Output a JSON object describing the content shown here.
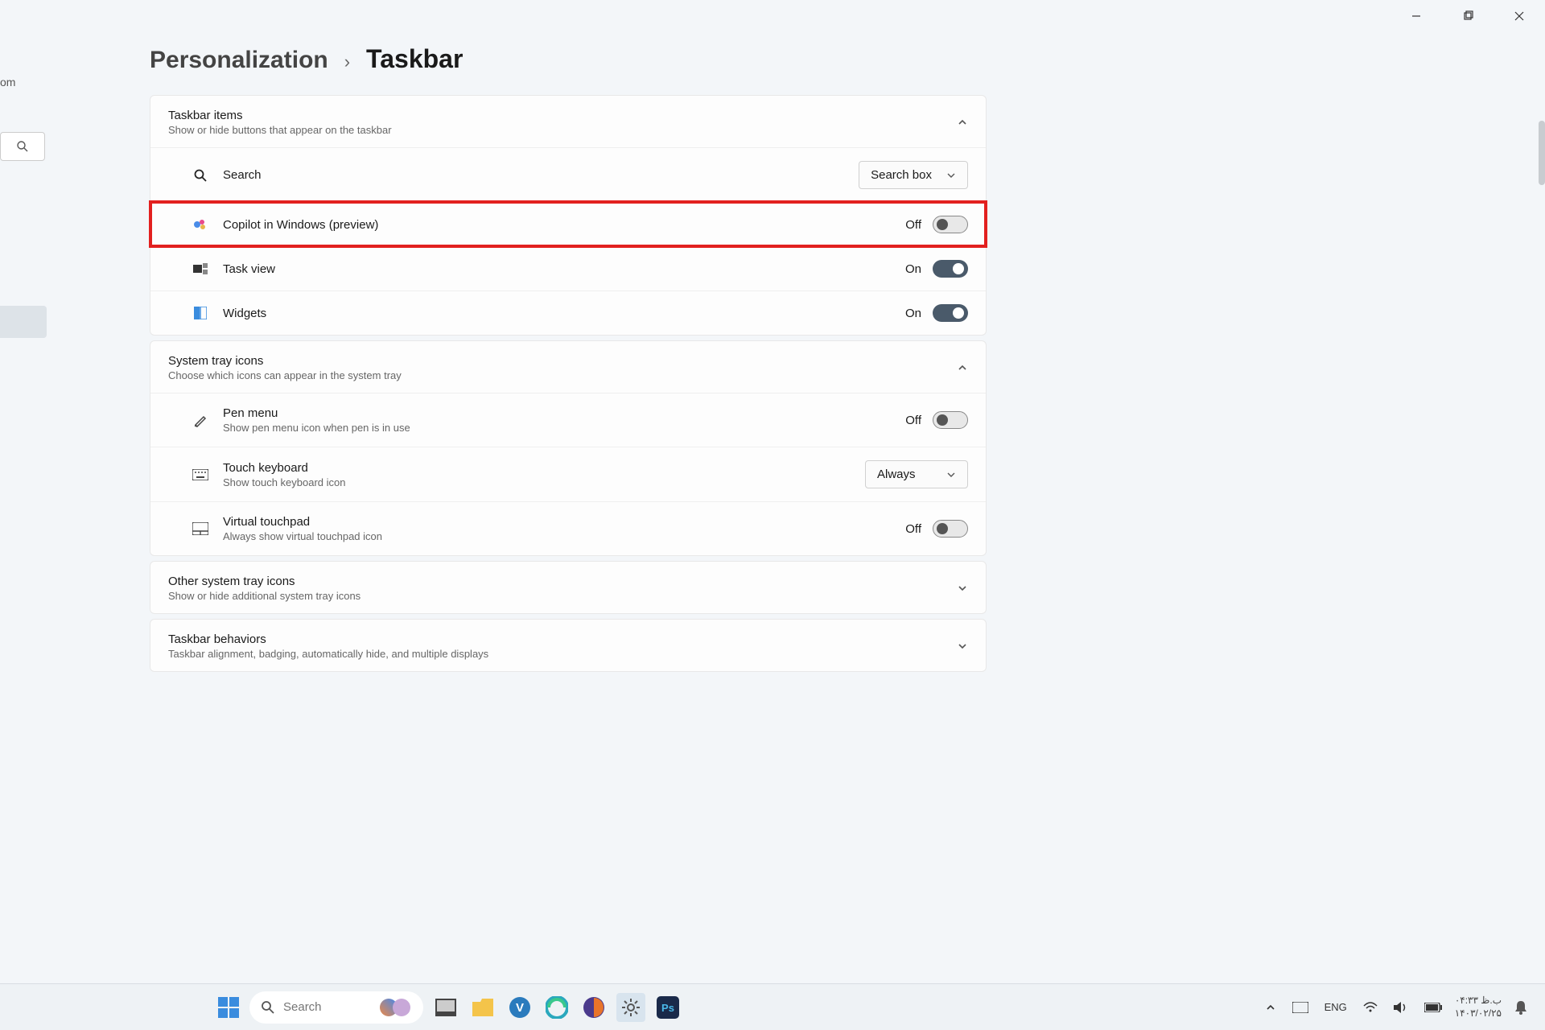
{
  "window": {
    "minimize": "—",
    "maximize": "▢",
    "close": "✕"
  },
  "sidebar": {
    "fragment_label": "om"
  },
  "breadcrumb": {
    "parent": "Personalization",
    "sep": "›",
    "current": "Taskbar"
  },
  "sections": {
    "taskbar_items": {
      "title": "Taskbar items",
      "subtitle": "Show or hide buttons that appear on the taskbar",
      "rows": {
        "search": {
          "label": "Search",
          "dropdown": "Search box"
        },
        "copilot": {
          "label": "Copilot in Windows (preview)",
          "state": "Off"
        },
        "taskview": {
          "label": "Task view",
          "state": "On"
        },
        "widgets": {
          "label": "Widgets",
          "state": "On"
        }
      }
    },
    "system_tray": {
      "title": "System tray icons",
      "subtitle": "Choose which icons can appear in the system tray",
      "rows": {
        "pen": {
          "label": "Pen menu",
          "sublabel": "Show pen menu icon when pen is in use",
          "state": "Off"
        },
        "touch_kbd": {
          "label": "Touch keyboard",
          "sublabel": "Show touch keyboard icon",
          "dropdown": "Always"
        },
        "vtouchpad": {
          "label": "Virtual touchpad",
          "sublabel": "Always show virtual touchpad icon",
          "state": "Off"
        }
      }
    },
    "other_tray": {
      "title": "Other system tray icons",
      "subtitle": "Show or hide additional system tray icons"
    },
    "behaviors": {
      "title": "Taskbar behaviors",
      "subtitle": "Taskbar alignment, badging, automatically hide, and multiple displays"
    }
  },
  "taskbar": {
    "search_placeholder": "Search",
    "tray": {
      "lang": "ENG",
      "time": "۰۴:۳۳ ب.ظ",
      "date": "۱۴۰۳/۰۲/۲۵"
    }
  }
}
